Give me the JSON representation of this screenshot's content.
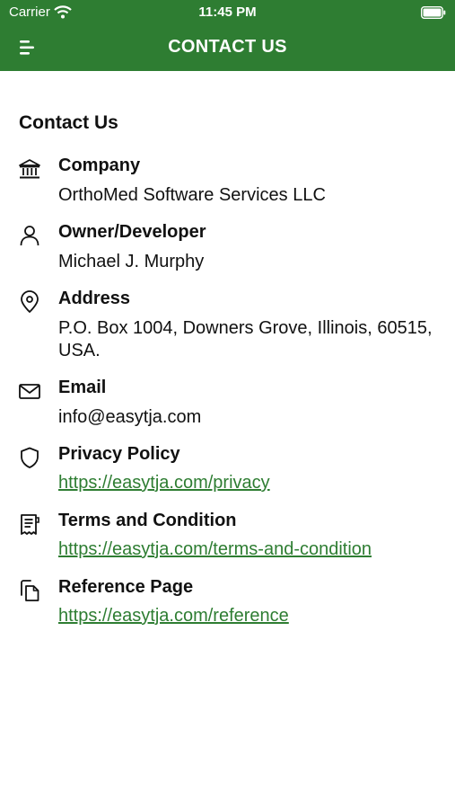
{
  "status_bar": {
    "carrier": "Carrier",
    "time": "11:45 PM"
  },
  "nav": {
    "title": "CONTACT US",
    "menu_icon": "hamburger-icon"
  },
  "section_title": "Contact Us",
  "colors": {
    "accent": "#2e7d32",
    "text": "#111111",
    "background": "#ffffff"
  },
  "items": [
    {
      "icon": "bank-icon",
      "label": "Company",
      "value": "OrthoMed Software Services LLC"
    },
    {
      "icon": "person-icon",
      "label": "Owner/Developer",
      "value": "Michael J. Murphy"
    },
    {
      "icon": "location-pin-icon",
      "label": "Address",
      "value": "P.O. Box 1004, Downers Grove, Illinois, 60515, USA."
    },
    {
      "icon": "envelope-icon",
      "label": "Email",
      "value": "info@easytja.com"
    },
    {
      "icon": "shield-icon",
      "label": "Privacy Policy",
      "link": "https://easytja.com/privacy"
    },
    {
      "icon": "receipt-icon",
      "label": "Terms and Condition",
      "link": "https://easytja.com/terms-and-condition"
    },
    {
      "icon": "copy-pages-icon",
      "label": "Reference Page",
      "link": "https://easytja.com/reference"
    }
  ]
}
